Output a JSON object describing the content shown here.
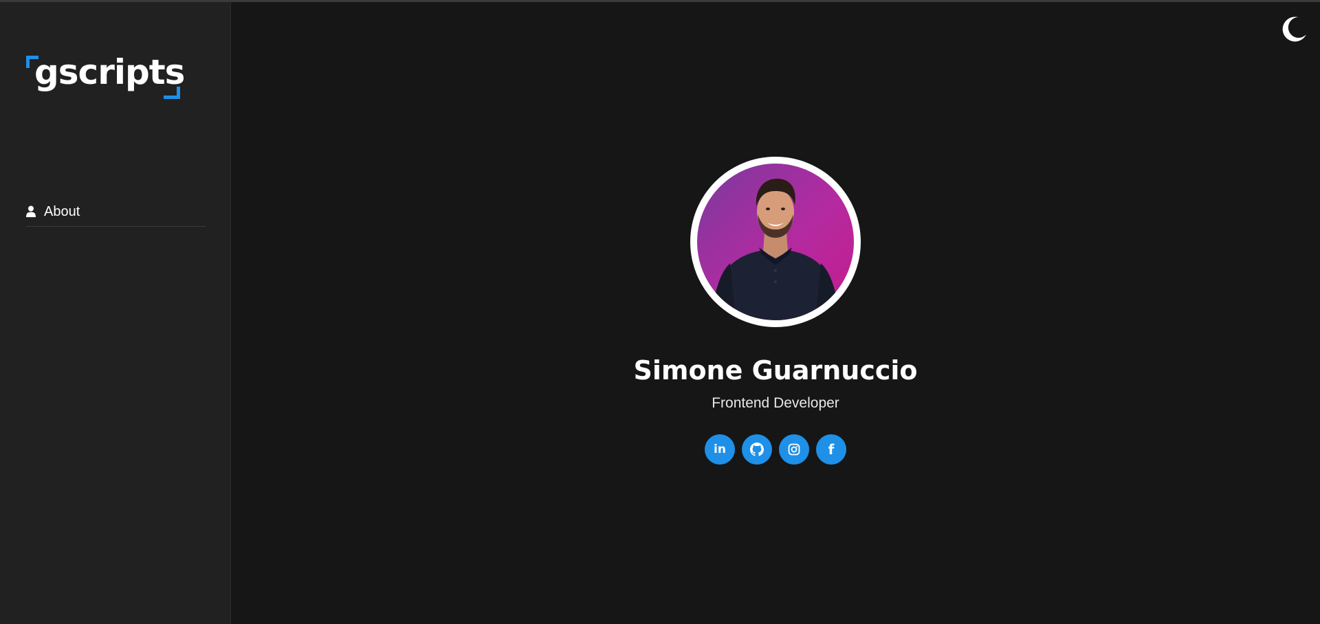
{
  "brand": {
    "logo_text": "gscripts",
    "accent_color": "#1e90e8"
  },
  "sidebar": {
    "items": [
      {
        "label": "About",
        "icon": "user-icon"
      }
    ]
  },
  "header": {
    "theme_toggle_icon": "moon-icon"
  },
  "profile": {
    "name": "Simone Guarnuccio",
    "role": "Frontend Developer",
    "socials": [
      {
        "icon": "linkedin-icon",
        "glyph": "in"
      },
      {
        "icon": "github-icon"
      },
      {
        "icon": "instagram-icon"
      },
      {
        "icon": "facebook-icon",
        "glyph": "f"
      }
    ]
  }
}
